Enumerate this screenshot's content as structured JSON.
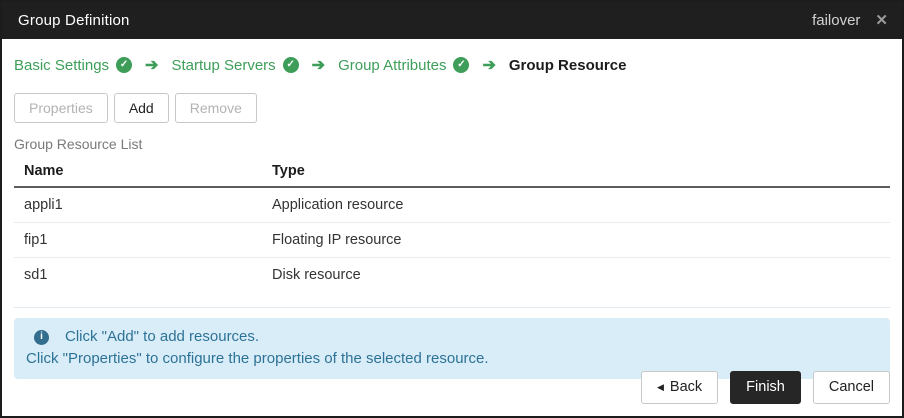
{
  "dialog": {
    "title": "Group Definition",
    "context_label": "failover"
  },
  "icons": {
    "close": "✕",
    "check": "✓",
    "arrow": "➔",
    "info": "i",
    "back_triangle": "◀"
  },
  "wizard": {
    "steps": [
      {
        "label": "Basic Settings",
        "completed": true,
        "current": false
      },
      {
        "label": "Startup Servers",
        "completed": true,
        "current": false
      },
      {
        "label": "Group Attributes",
        "completed": true,
        "current": false
      },
      {
        "label": "Group Resource",
        "completed": false,
        "current": true
      }
    ]
  },
  "toolbar": {
    "properties_label": "Properties",
    "add_label": "Add",
    "remove_label": "Remove"
  },
  "list": {
    "caption": "Group Resource List",
    "columns": [
      "Name",
      "Type"
    ],
    "rows": [
      {
        "name": "appli1",
        "type": "Application resource"
      },
      {
        "name": "fip1",
        "type": "Floating IP resource"
      },
      {
        "name": "sd1",
        "type": "Disk resource"
      }
    ]
  },
  "info": {
    "line1": "Click \"Add\" to add resources.",
    "line2": "Click \"Properties\" to configure the properties of the selected resource."
  },
  "footer": {
    "back_label": "Back",
    "finish_label": "Finish",
    "cancel_label": "Cancel"
  },
  "colors": {
    "titlebar_bg": "#1f1f1f",
    "accent_green": "#3e9e59",
    "info_bg": "#d9edf8",
    "info_text": "#2d7296",
    "finish_button_bg": "#262626"
  }
}
